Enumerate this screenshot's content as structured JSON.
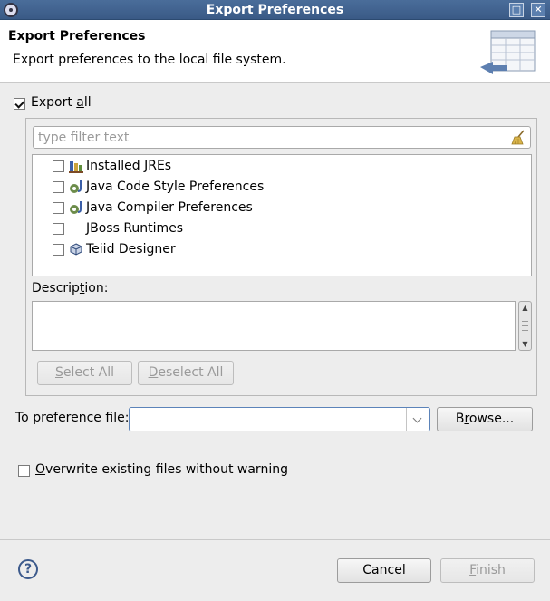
{
  "window": {
    "title": "Export Preferences",
    "controls": [
      "restore",
      "close"
    ]
  },
  "header": {
    "title": "Export Preferences",
    "description": "Export preferences to the local file system.",
    "banner_icon": "table-export-banner-icon"
  },
  "export_all": {
    "label_prefix": "Export ",
    "label_mnemonic": "a",
    "label_suffix": "ll",
    "checked": true
  },
  "filter": {
    "value": "",
    "placeholder": "type filter text",
    "clear_icon": "broom-icon"
  },
  "tree": {
    "items": [
      {
        "label": "Installed JREs",
        "checked": false,
        "icon": "jre-library-icon"
      },
      {
        "label": "Java Code Style Preferences",
        "checked": false,
        "icon": "java-prefs-icon"
      },
      {
        "label": "Java Compiler Preferences",
        "checked": false,
        "icon": "java-prefs-icon"
      },
      {
        "label": "JBoss Runtimes",
        "checked": false,
        "icon": ""
      },
      {
        "label": "Teiid Designer",
        "checked": false,
        "icon": "teiid-cube-icon"
      }
    ]
  },
  "description": {
    "label_prefix": "Descrip",
    "label_mnemonic": "t",
    "label_suffix": "ion:",
    "value": ""
  },
  "buttons": {
    "select_all": {
      "mnemonic": "S",
      "rest": "elect All",
      "enabled": false
    },
    "deselect_all": {
      "mnemonic": "D",
      "rest": "eselect All",
      "enabled": false
    },
    "browse": {
      "prefix": "B",
      "mnemonic": "r",
      "rest": "owse..."
    },
    "cancel": "Cancel",
    "finish": {
      "mnemonic": "F",
      "rest": "inish",
      "enabled": false
    }
  },
  "preference_file": {
    "label": "To preference file:",
    "value": ""
  },
  "overwrite": {
    "mnemonic": "O",
    "rest": "verwrite existing files without warning",
    "checked": false
  },
  "help": {
    "glyph": "?"
  }
}
